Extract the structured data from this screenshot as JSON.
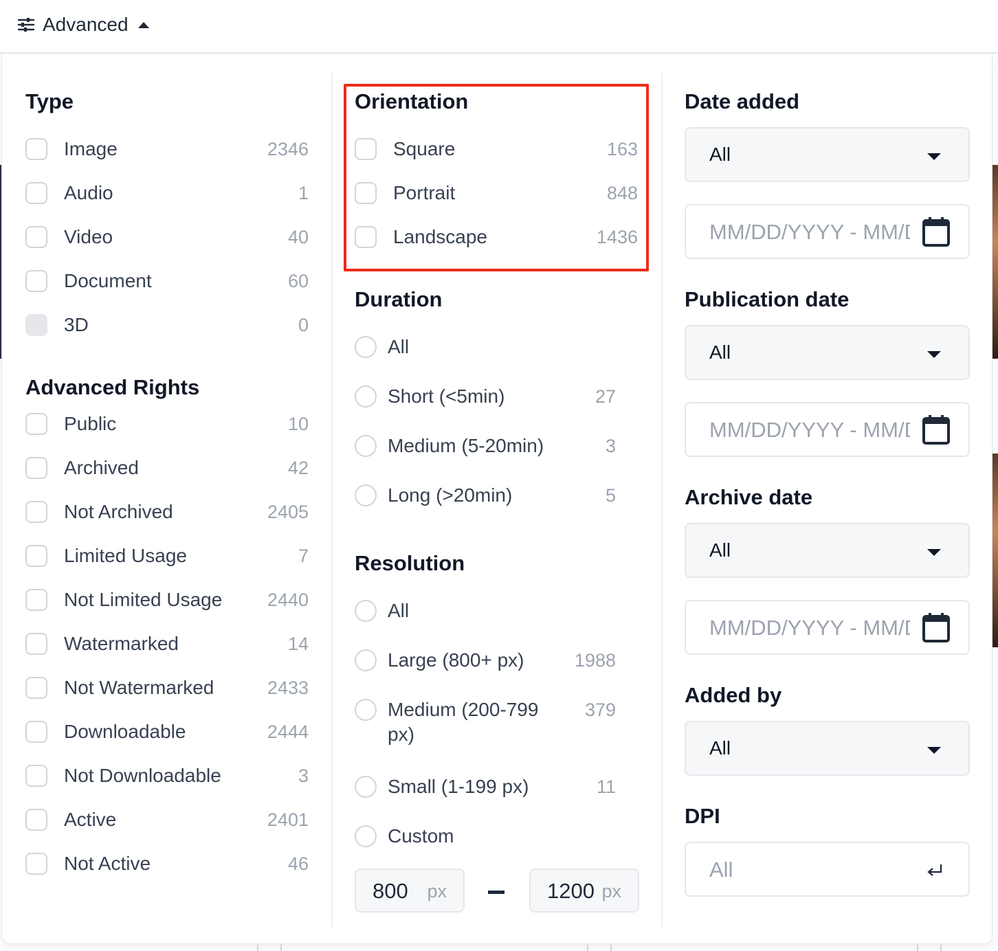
{
  "header": {
    "advanced_label": "Advanced"
  },
  "type": {
    "title": "Type",
    "items": [
      {
        "label": "Image",
        "count": "2346",
        "disabled": false
      },
      {
        "label": "Audio",
        "count": "1",
        "disabled": false
      },
      {
        "label": "Video",
        "count": "40",
        "disabled": false
      },
      {
        "label": "Document",
        "count": "60",
        "disabled": false
      },
      {
        "label": "3D",
        "count": "0",
        "disabled": true
      }
    ]
  },
  "rights": {
    "title": "Advanced Rights",
    "items": [
      {
        "label": "Public",
        "count": "10"
      },
      {
        "label": "Archived",
        "count": "42"
      },
      {
        "label": "Not Archived",
        "count": "2405"
      },
      {
        "label": "Limited Usage",
        "count": "7"
      },
      {
        "label": "Not Limited Usage",
        "count": "2440"
      },
      {
        "label": "Watermarked",
        "count": "14"
      },
      {
        "label": "Not Watermarked",
        "count": "2433"
      },
      {
        "label": "Downloadable",
        "count": "2444"
      },
      {
        "label": "Not Downloadable",
        "count": "3"
      },
      {
        "label": "Active",
        "count": "2401"
      },
      {
        "label": "Not Active",
        "count": "46"
      }
    ]
  },
  "orientation": {
    "title": "Orientation",
    "items": [
      {
        "label": "Square",
        "count": "163"
      },
      {
        "label": "Portrait",
        "count": "848"
      },
      {
        "label": "Landscape",
        "count": "1436"
      }
    ]
  },
  "duration": {
    "title": "Duration",
    "items": [
      {
        "label": "All",
        "count": ""
      },
      {
        "label": "Short (<5min)",
        "count": "27"
      },
      {
        "label": "Medium (5-20min)",
        "count": "3"
      },
      {
        "label": "Long (>20min)",
        "count": "5"
      }
    ]
  },
  "resolution": {
    "title": "Resolution",
    "items": [
      {
        "label": "All",
        "count": ""
      },
      {
        "label": "Large (800+ px)",
        "count": "1988"
      },
      {
        "label_line1": "Medium (200-799",
        "label_line2": "px)",
        "count": "379"
      },
      {
        "label": "Small (1-199 px)",
        "count": "11"
      },
      {
        "label": "Custom",
        "count": ""
      }
    ],
    "custom_min": "800",
    "custom_max": "1200",
    "unit": "px"
  },
  "date_added": {
    "title": "Date added",
    "select_value": "All",
    "placeholder": "MM/DD/YYYY - MM/DD/YYYY"
  },
  "publication_date": {
    "title": "Publication date",
    "select_value": "All",
    "placeholder": "MM/DD/YYYY - MM/DD/YYYY"
  },
  "archive_date": {
    "title": "Archive date",
    "select_value": "All",
    "placeholder": "MM/DD/YYYY - MM/DD/YYYY"
  },
  "added_by": {
    "title": "Added by",
    "select_value": "All"
  },
  "dpi": {
    "title": "DPI",
    "placeholder": "All"
  },
  "colors": {
    "highlight": "#ee2c1b",
    "border": "#e5e7eb",
    "muted": "#9ca3af"
  }
}
